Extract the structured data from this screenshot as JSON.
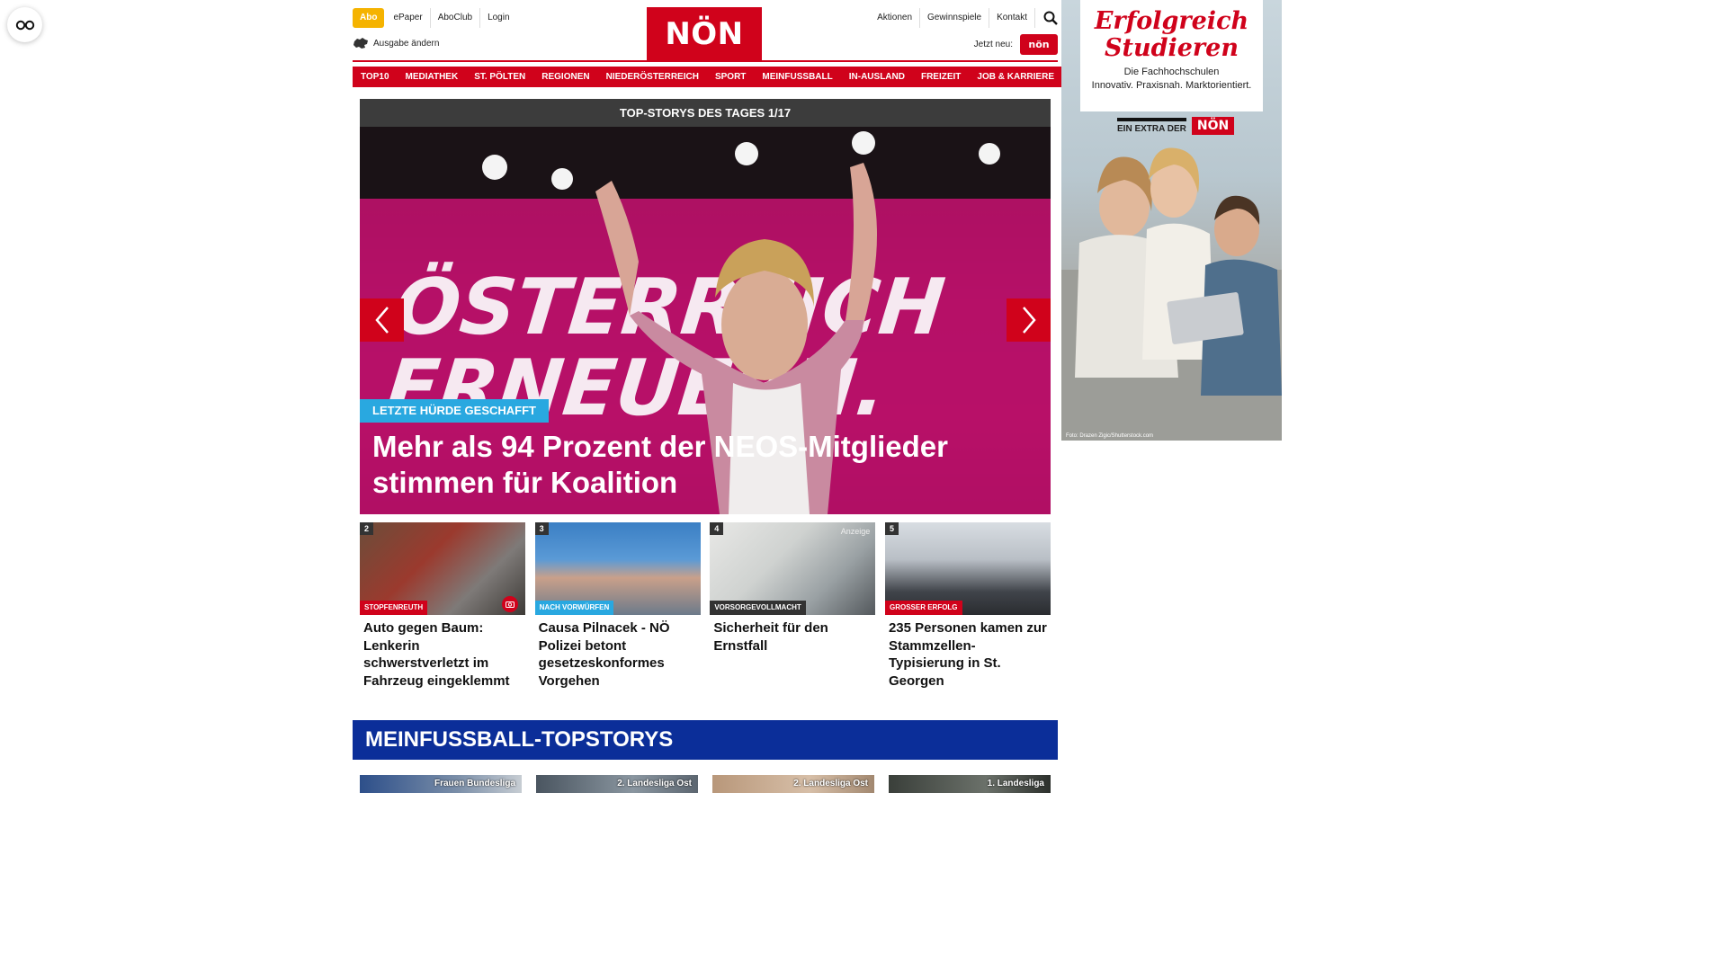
{
  "header": {
    "abo_label": "Abo",
    "top_links": [
      "ePaper",
      "AboClub",
      "Login"
    ],
    "ausgabe_label": "Ausgabe ändern",
    "logo_text": "NÖN",
    "right_links": [
      "Aktionen",
      "Gewinnspiele",
      "Kontakt"
    ],
    "jetzt_neu_label": "Jetzt neu:",
    "jetzt_badge_text": "nön"
  },
  "nav": {
    "items": [
      "TOP10",
      "MEDIATHEK",
      "ST. PÖLTEN",
      "REGIONEN",
      "NIEDERÖSTERREICH",
      "SPORT",
      "MEINFUSSBALL",
      "IN-AUSLAND",
      "FREIZEIT",
      "JOB & KARRIERE"
    ]
  },
  "hero": {
    "header": "TOP-STORYS DES TAGES 1/17",
    "tag": "LETZTE HÜRDE GESCHAFFT",
    "title": "Mehr als 94 Prozent der NEOS-Mitglieder stimmen für Koalition",
    "backdrop_text": "ÖSTERREICH ERNEUERN."
  },
  "cards": [
    {
      "num": "2",
      "tag": "STOPFENREUTH",
      "tag_color": "#d0021b",
      "title": "Auto gegen Baum: Lenkerin schwerstverletzt im Fahrzeug eingeklemmt",
      "has_camera": true
    },
    {
      "num": "3",
      "tag": "NACH VORWÜRFEN",
      "tag_color": "#29a8e0",
      "title": "Causa Pilnacek - NÖ Polizei betont gesetzeskonformes Vorgehen",
      "has_camera": false
    },
    {
      "num": "4",
      "tag": "VORSORGEVOLLMACHT",
      "tag_color": "#333333",
      "title": "Sicherheit für den Ernstfall",
      "has_camera": false,
      "anzeige": "Anzeige"
    },
    {
      "num": "5",
      "tag": "GROSSER ERFOLG",
      "tag_color": "#d0021b",
      "title": "235 Personen kamen zur Stammzellen-Typisierung in St. Georgen",
      "has_camera": false
    }
  ],
  "meinfussball": {
    "heading": "MEINFUSSBALL-TOPSTORYS",
    "thumb_labels": [
      "Frauen Bundesliga",
      "2. Landesliga Ost",
      "2. Landesliga Ost",
      "1. Landesliga"
    ]
  },
  "ad": {
    "title_line1": "Erfolgreich",
    "title_line2": "Studieren",
    "subtitle_line1": "Die Fachhochschulen",
    "subtitle_line2": "Innovativ. Praxisnah. Marktorientiert.",
    "extra_label": "EIN EXTRA DER",
    "extra_logo": "NÖN",
    "photo_credit": "Foto: Drazen Zigic/Shutterstock.com"
  },
  "colors": {
    "brand_red": "#d0021b",
    "abo_yellow": "#f5b300",
    "tag_blue": "#29a8e0",
    "meinfussball_blue": "#0b2e99",
    "hero_header_gray": "#3c3c3c"
  },
  "icons": {
    "reader": "glasses-icon",
    "search": "search-icon",
    "ausgabe": "lower-austria-map-icon",
    "slider_prev": "chevron-left-icon",
    "slider_next": "chevron-right-icon",
    "gallery": "camera-icon"
  }
}
